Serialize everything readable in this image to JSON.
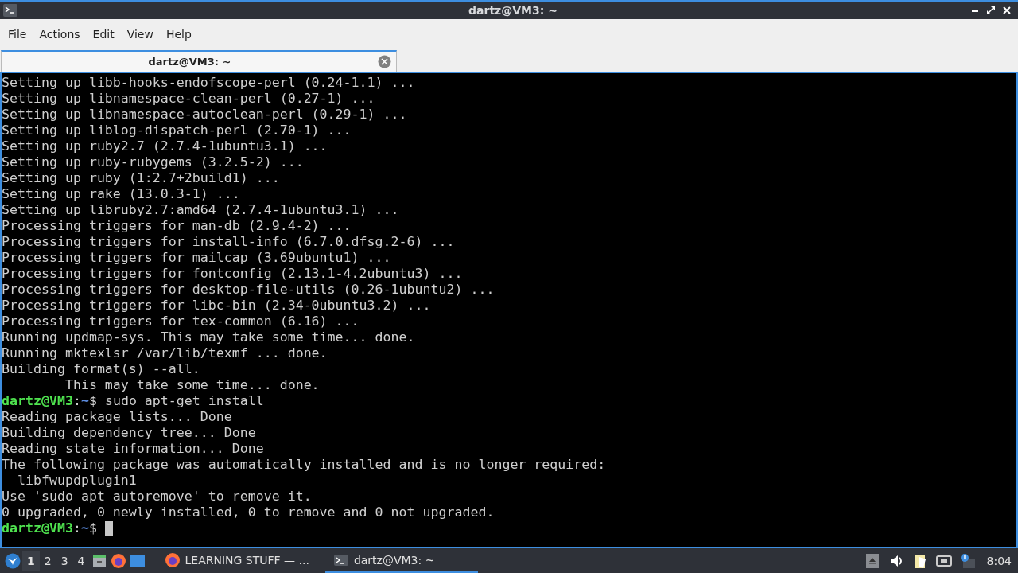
{
  "window": {
    "title": "dartz@VM3: ~"
  },
  "menu": [
    "File",
    "Actions",
    "Edit",
    "View",
    "Help"
  ],
  "tabs": [
    {
      "label": "dartz@VM3: ~",
      "selected": true
    }
  ],
  "terminal": {
    "lines": [
      {
        "kind": "output",
        "text": "Setting up libb-hooks-endofscope-perl (0.24-1.1) ..."
      },
      {
        "kind": "output",
        "text": "Setting up libnamespace-clean-perl (0.27-1) ..."
      },
      {
        "kind": "output",
        "text": "Setting up libnamespace-autoclean-perl (0.29-1) ..."
      },
      {
        "kind": "output",
        "text": "Setting up liblog-dispatch-perl (2.70-1) ..."
      },
      {
        "kind": "output",
        "text": "Setting up ruby2.7 (2.7.4-1ubuntu3.1) ..."
      },
      {
        "kind": "output",
        "text": "Setting up ruby-rubygems (3.2.5-2) ..."
      },
      {
        "kind": "output",
        "text": "Setting up ruby (1:2.7+2build1) ..."
      },
      {
        "kind": "output",
        "text": "Setting up rake (13.0.3-1) ..."
      },
      {
        "kind": "output",
        "text": "Setting up libruby2.7:amd64 (2.7.4-1ubuntu3.1) ..."
      },
      {
        "kind": "output",
        "text": "Processing triggers for man-db (2.9.4-2) ..."
      },
      {
        "kind": "output",
        "text": "Processing triggers for install-info (6.7.0.dfsg.2-6) ..."
      },
      {
        "kind": "output",
        "text": "Processing triggers for mailcap (3.69ubuntu1) ..."
      },
      {
        "kind": "output",
        "text": "Processing triggers for fontconfig (2.13.1-4.2ubuntu3) ..."
      },
      {
        "kind": "output",
        "text": "Processing triggers for desktop-file-utils (0.26-1ubuntu2) ..."
      },
      {
        "kind": "output",
        "text": "Processing triggers for libc-bin (2.34-0ubuntu3.2) ..."
      },
      {
        "kind": "output",
        "text": "Processing triggers for tex-common (6.16) ..."
      },
      {
        "kind": "output",
        "text": "Running updmap-sys. This may take some time... done."
      },
      {
        "kind": "output",
        "text": "Running mktexlsr /var/lib/texmf ... done."
      },
      {
        "kind": "output",
        "text": "Building format(s) --all."
      },
      {
        "kind": "output",
        "text": "        This may take some time... done."
      },
      {
        "kind": "prompt",
        "user_host": "dartz@VM3",
        "separator": ":",
        "path": "~",
        "symbol": "$",
        "command": "sudo apt-get install"
      },
      {
        "kind": "output",
        "text": "Reading package lists... Done"
      },
      {
        "kind": "output",
        "text": "Building dependency tree... Done"
      },
      {
        "kind": "output",
        "text": "Reading state information... Done"
      },
      {
        "kind": "output",
        "text": "The following package was automatically installed and is no longer required:"
      },
      {
        "kind": "output",
        "text": "  libfwupdplugin1"
      },
      {
        "kind": "output",
        "text": "Use 'sudo apt autoremove' to remove it."
      },
      {
        "kind": "output",
        "text": "0 upgraded, 0 newly installed, 0 to remove and 0 not upgraded."
      },
      {
        "kind": "prompt",
        "user_host": "dartz@VM3",
        "separator": ":",
        "path": "~",
        "symbol": "$",
        "cursor": true
      }
    ]
  },
  "taskbar": {
    "desktops": [
      {
        "label": "1",
        "selected": true
      },
      {
        "label": "2",
        "selected": false
      },
      {
        "label": "3",
        "selected": false
      },
      {
        "label": "4",
        "selected": false
      }
    ],
    "tasks": [
      {
        "kind": "browser",
        "label": "LEARNING STUFF — ...",
        "selected": false
      },
      {
        "kind": "terminal",
        "label": "dartz@VM3: ~",
        "selected": true
      }
    ],
    "clock": "8:04"
  }
}
